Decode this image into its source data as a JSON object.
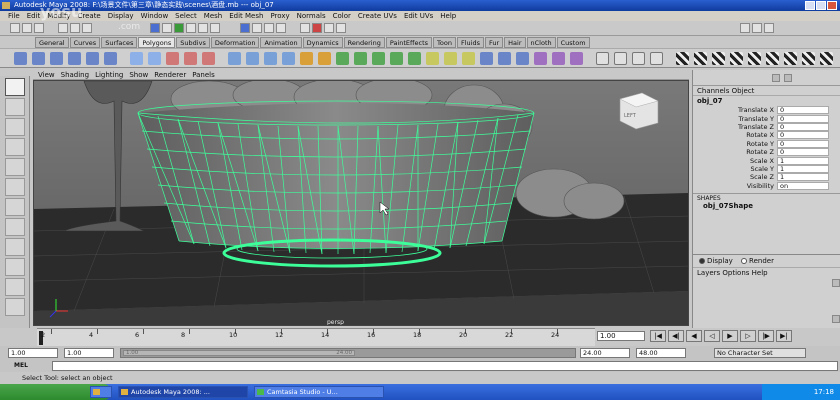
{
  "window": {
    "title": "Autodesk Maya 2008: F:\\场景文件\\第三章\\静态实践\\scenes\\酒盘.mb    ---    obj_07"
  },
  "watermark": {
    "text": "yosu",
    "sub": ".com"
  },
  "menubar": [
    "File",
    "Edit",
    "Modify",
    "Create",
    "Display",
    "Window",
    "Select",
    "Mesh",
    "Edit Mesh",
    "Proxy",
    "Normals",
    "Color",
    "Create UVs",
    "Edit UVs",
    "Help"
  ],
  "shelf_tabs": [
    "General",
    "Curves",
    "Surfaces",
    "Polygons",
    "Subdivs",
    "Deformation",
    "Animation",
    "Dynamics",
    "Rendering",
    "PaintEffects",
    "Toon",
    "Fluids",
    "Fur",
    "Hair",
    "nCloth",
    "Custom"
  ],
  "active_shelf_tab": "Polygons",
  "panel_menu": [
    "View",
    "Shading",
    "Lighting",
    "Show",
    "Renderer",
    "Panels"
  ],
  "viewport": {
    "camera": "persp",
    "viewcube_label": "LEFT",
    "wire_color": "#3dff9a",
    "bg_color": "#6b6b6b"
  },
  "channel_box": {
    "menu": [
      "Channels",
      "Object"
    ],
    "object": "obj_07",
    "attributes": [
      {
        "name": "Translate X",
        "value": "0"
      },
      {
        "name": "Translate Y",
        "value": "0"
      },
      {
        "name": "Translate Z",
        "value": "0"
      },
      {
        "name": "Rotate X",
        "value": "0"
      },
      {
        "name": "Rotate Y",
        "value": "0"
      },
      {
        "name": "Rotate Z",
        "value": "0"
      },
      {
        "name": "Scale X",
        "value": "1"
      },
      {
        "name": "Scale Y",
        "value": "1"
      },
      {
        "name": "Scale Z",
        "value": "1"
      },
      {
        "name": "Visibility",
        "value": "on"
      }
    ],
    "shapes_header": "SHAPES",
    "shape": "obj_07Shape",
    "layer_modes": [
      "Display",
      "Render"
    ],
    "layers_menu": [
      "Layers",
      "Options",
      "Help"
    ]
  },
  "timeline": {
    "ticks": [
      "2",
      "4",
      "6",
      "8",
      "10",
      "12",
      "14",
      "16",
      "18",
      "20",
      "22",
      "24"
    ],
    "current_frame": "1.00"
  },
  "range": {
    "start": "1.00",
    "start_inner": "1.00",
    "handle_start": "1.00",
    "handle_end": "24.00",
    "end_inner": "24.00",
    "end": "48.00",
    "character_set": "No Character Set"
  },
  "command_line": {
    "label": "MEL"
  },
  "help_line": "Select Tool: select an object",
  "taskbar": {
    "tasks": [
      {
        "label": "",
        "active": false
      },
      {
        "label": "Autodesk Maya 2008: ...",
        "active": true
      },
      {
        "label": "Camtasia Studio - U...",
        "active": false
      }
    ],
    "clock": "17:18"
  }
}
